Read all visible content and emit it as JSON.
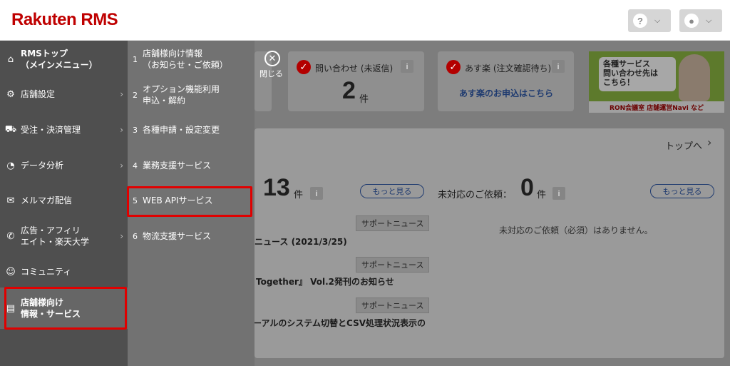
{
  "header": {
    "logo": "Rakuten RMS",
    "help_icon_text": "?",
    "chevron": "⌄"
  },
  "widgets": {
    "inquiry": {
      "label": "問い合わせ (未返信)",
      "count": "2",
      "unit": "件"
    },
    "asuraku": {
      "label": "あす楽 (注文確認待ち)",
      "link": "あす楽のお申込はこちら"
    },
    "banner": {
      "bubble_line1": "各種サービス",
      "bubble_line2": "問い合わせ先は",
      "bubble_line3": "こちら！",
      "footer": "RON会議室 店舗運営Navi など"
    }
  },
  "panel": {
    "top_link": "トップへ",
    "count_left": "13",
    "unit_left": "件",
    "more_left": "もっと見る",
    "unhandled_label": "未対応のご依頼：",
    "count_right": "0",
    "unit_right": "件",
    "more_right": "もっと見る",
    "no_requests": "未対応のご依頼（必須）はありません。",
    "news": [
      {
        "tag": "サポートニュース",
        "title": "ニュース (2021/3/25)"
      },
      {
        "tag": "サポートニュース",
        "title": "Together』 Vol.2発刊のお知らせ"
      },
      {
        "tag": "サポートニュース",
        "title": "ーアルのシステム切替とCSV処理状況表示の"
      }
    ]
  },
  "close": {
    "label": "閉じる"
  },
  "menu": {
    "items": [
      {
        "label": "RMSトップ\n（メインメニュー）",
        "icon": "home-icon",
        "glyph": "⌂"
      },
      {
        "label": "店舗設定",
        "icon": "gear-icon",
        "glyph": "⚙"
      },
      {
        "label": "受注・決済管理",
        "icon": "cart-icon",
        "glyph": "⛟"
      },
      {
        "label": "データ分析",
        "icon": "pie-chart-icon",
        "glyph": "◔"
      },
      {
        "label": "メルマガ配信",
        "icon": "mail-icon",
        "glyph": "✉"
      },
      {
        "label": "広告・アフィリ\nエイト・楽天大学",
        "icon": "megaphone-icon",
        "glyph": "✆"
      },
      {
        "label": "コミュニティ",
        "icon": "people-icon",
        "glyph": "☺"
      },
      {
        "label": "店舗様向け\n情報・サービス",
        "icon": "document-icon",
        "glyph": "▤"
      }
    ],
    "arrow": "›"
  },
  "submenu": {
    "items": [
      {
        "num": "1",
        "label": "店舗様向け情報\n（お知らせ・ご依頼）"
      },
      {
        "num": "2",
        "label": "オプション機能利用\n申込・解約"
      },
      {
        "num": "3",
        "label": "各種申請・設定変更"
      },
      {
        "num": "4",
        "label": "業務支援サービス"
      },
      {
        "num": "5",
        "label": "WEB APIサービス"
      },
      {
        "num": "6",
        "label": "物流支援サービス"
      }
    ]
  }
}
